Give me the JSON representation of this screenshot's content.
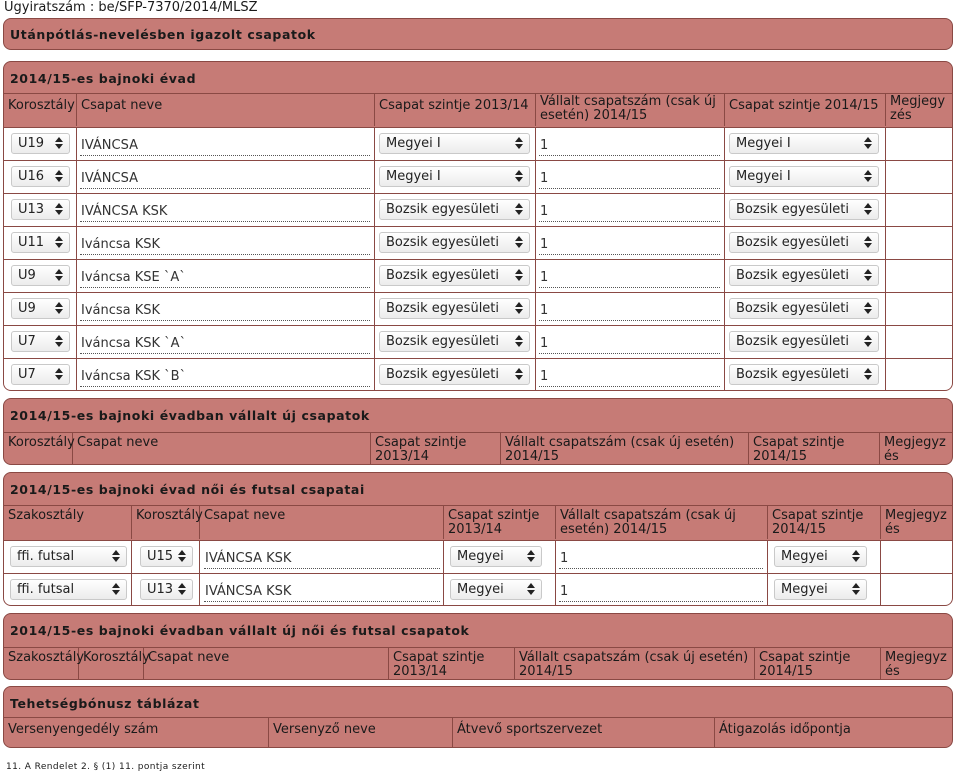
{
  "doc": {
    "ref": "Ügyiratszám : be/SFP-7370/2014/MLSZ",
    "footnote": "11. A Rendelet 2. § (1) 11. pontja szerint"
  },
  "s1": {
    "title": "Utánpótlás-nevelésben igazolt csapatok"
  },
  "s2": {
    "title": "2014/15-es bajnoki évad",
    "headers": [
      "Korosztály",
      "Csapat neve",
      "Csapat szintje 2013/14",
      "Vállalt csapatszám (csak új esetén) 2014/15",
      "Csapat szintje 2014/15",
      "Megjegyzés"
    ],
    "rows": [
      {
        "age": "U19",
        "team": "IVÁNCSA",
        "lvl13": "Megyei I",
        "count": "1",
        "lvl14": "Megyei I"
      },
      {
        "age": "U16",
        "team": "IVÁNCSA",
        "lvl13": "Megyei I",
        "count": "1",
        "lvl14": "Megyei I"
      },
      {
        "age": "U13",
        "team": "IVÁNCSA KSK",
        "lvl13": "Bozsik egyesületi",
        "count": "1",
        "lvl14": "Bozsik egyesületi"
      },
      {
        "age": "U11",
        "team": "Iváncsa KSK",
        "lvl13": "Bozsik egyesületi",
        "count": "1",
        "lvl14": "Bozsik egyesületi"
      },
      {
        "age": "U9",
        "team": "Iváncsa KSE `A`",
        "lvl13": "Bozsik egyesületi",
        "count": "1",
        "lvl14": "Bozsik egyesületi"
      },
      {
        "age": "U9",
        "team": "Iváncsa KSK",
        "lvl13": "Bozsik egyesületi",
        "count": "1",
        "lvl14": "Bozsik egyesületi"
      },
      {
        "age": "U7",
        "team": "Iváncsa KSK `A`",
        "lvl13": "Bozsik egyesületi",
        "count": "1",
        "lvl14": "Bozsik egyesületi"
      },
      {
        "age": "U7",
        "team": "Iváncsa KSK `B`",
        "lvl13": "Bozsik egyesületi",
        "count": "1",
        "lvl14": "Bozsik egyesületi"
      }
    ]
  },
  "s3": {
    "title": "2014/15-es bajnoki évadban vállalt új csapatok",
    "headers": [
      "Korosztály",
      "Csapat neve",
      "Csapat szintje 2013/14",
      "Vállalt csapatszám (csak új esetén) 2014/15",
      "Csapat szintje 2014/15",
      "Megjegyzés"
    ]
  },
  "s4": {
    "title": "2014/15-es bajnoki évad női és futsal csapatai",
    "headers": [
      "Szakosztály",
      "Korosztály",
      "Csapat neve",
      "Csapat szintje 2013/14",
      "Vállalt csapatszám (csak új esetén) 2014/15",
      "Csapat szintje 2014/15",
      "Megjegyzés"
    ],
    "rows": [
      {
        "dept": "ffi. futsal",
        "age": "U15",
        "team": "IVÁNCSA KSK",
        "lvl13": "Megyei",
        "count": "1",
        "lvl14": "Megyei"
      },
      {
        "dept": "ffi. futsal",
        "age": "U13",
        "team": "IVÁNCSA KSK",
        "lvl13": "Megyei",
        "count": "1",
        "lvl14": "Megyei"
      }
    ]
  },
  "s5": {
    "title": "2014/15-es bajnoki évadban vállalt új női és futsal csapatok",
    "headers": [
      "Szakosztály",
      "Korosztály",
      "Csapat neve",
      "Csapat szintje 2013/14",
      "Vállalt csapatszám (csak új esetén) 2014/15",
      "Csapat szintje 2014/15",
      "Megjegyzés"
    ]
  },
  "s6": {
    "title": "Tehetségbónusz táblázat",
    "headers": [
      "Versenyengedély szám",
      "Versenyző neve",
      "Átvevő sportszervezet",
      "Átigazolás időpontja"
    ]
  }
}
